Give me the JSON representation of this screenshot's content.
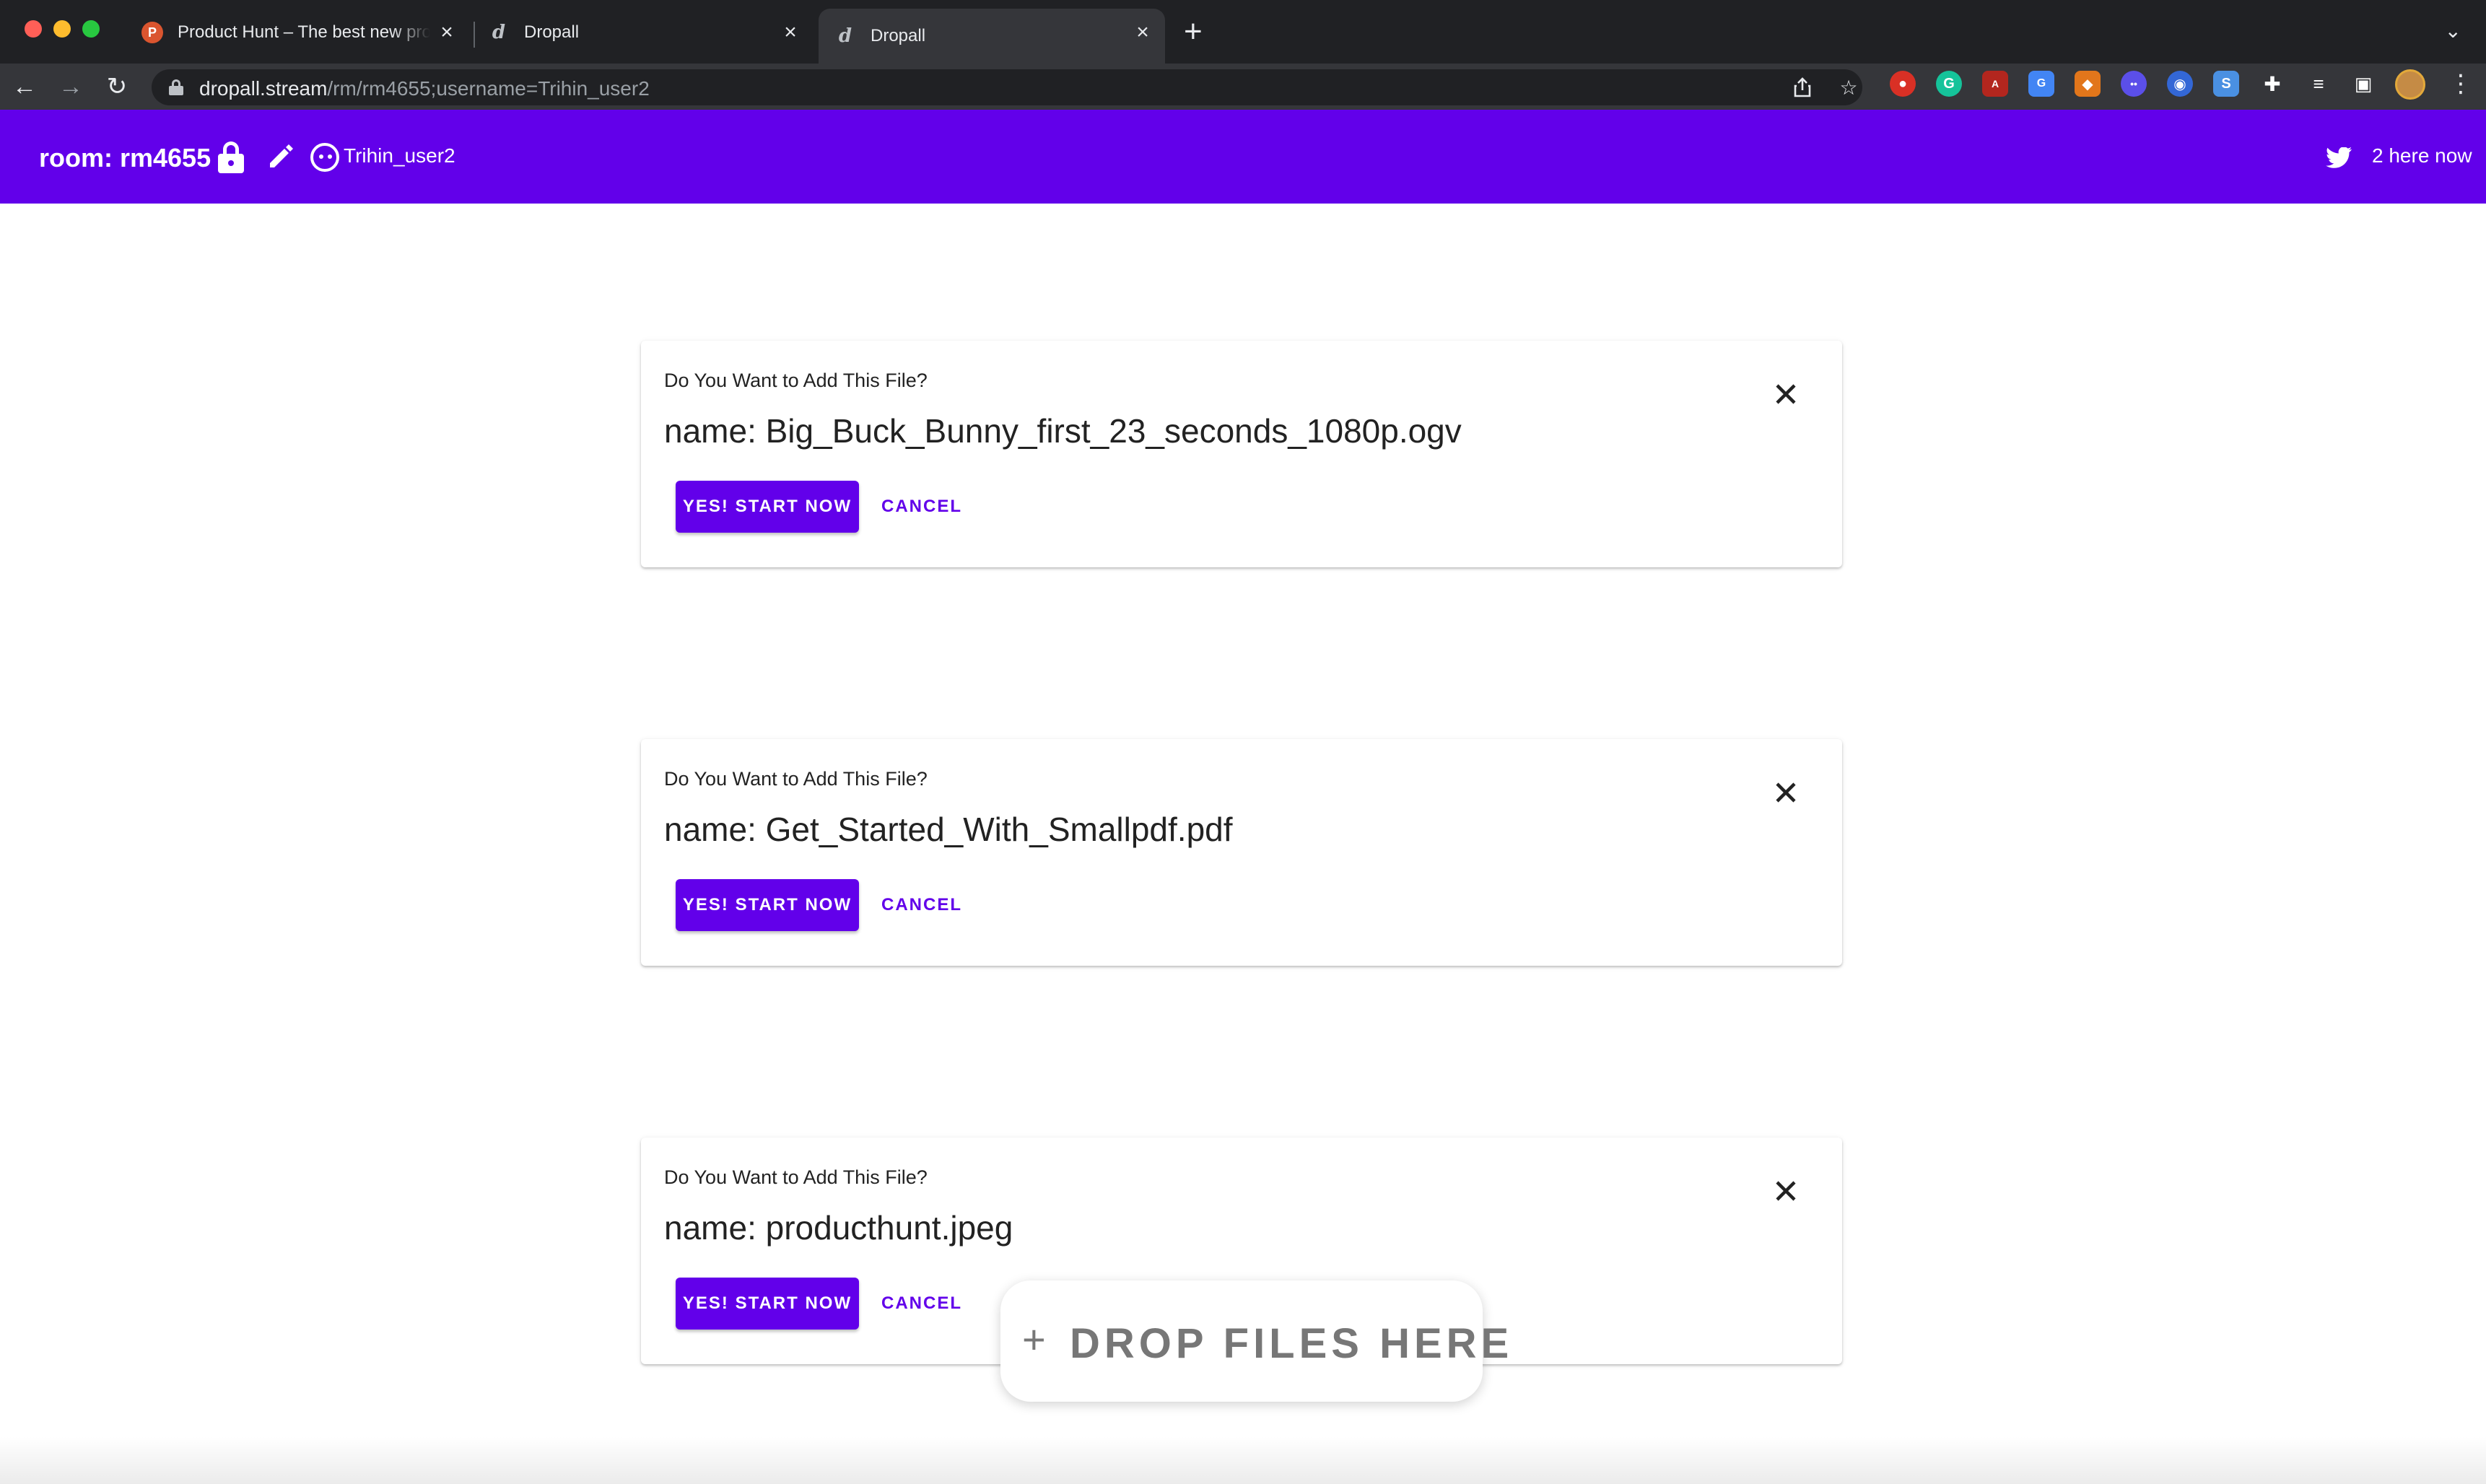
{
  "browser": {
    "tabs": [
      {
        "title": "Product Hunt – The best new products in tech.",
        "favicon": "product-hunt-icon"
      },
      {
        "title": "Dropall",
        "favicon": "dropall-icon"
      },
      {
        "title": "Dropall",
        "favicon": "dropall-icon",
        "active": true
      }
    ],
    "url_host": "dropall.stream",
    "url_path": "/rm/rm4655;username=Trihin_user2",
    "extensions": [
      "adblock-icon",
      "grammarly-icon",
      "pdf-icon",
      "translate-icon",
      "metamask-icon",
      "chat-icon",
      "record-icon",
      "s-icon",
      "puzzle-icon"
    ]
  },
  "appbar": {
    "room_label": "room: rm4655",
    "username": "Trihin_user2",
    "presence": "2 here now",
    "accent_color": "#6200ea"
  },
  "cards": [
    {
      "question": "Do You Want to Add This File?",
      "name": "name: Big_Buck_Bunny_first_23_seconds_1080p.ogv",
      "yes_label": "YES! START NOW",
      "cancel_label": "CANCEL"
    },
    {
      "question": "Do You Want to Add This File?",
      "name": "name: Get_Started_With_Smallpdf.pdf",
      "yes_label": "YES! START NOW",
      "cancel_label": "CANCEL"
    },
    {
      "question": "Do You Want to Add This File?",
      "name": "name: producthunt.jpeg",
      "yes_label": "YES! START NOW",
      "cancel_label": "CANCEL"
    }
  ],
  "dropzone": {
    "plus": "+",
    "label": "DROP FILES HERE"
  }
}
